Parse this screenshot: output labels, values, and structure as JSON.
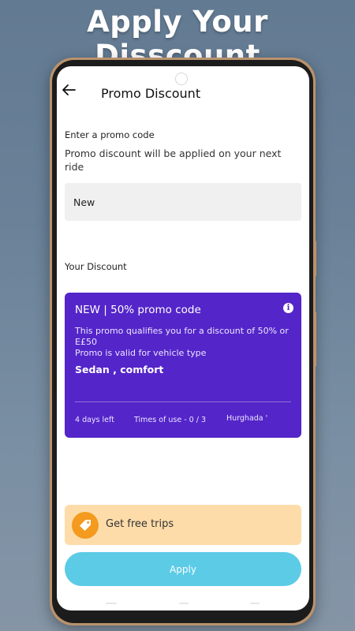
{
  "banner": {
    "headline": "Apply Your Disscount"
  },
  "header": {
    "title": "Promo Discount",
    "back_icon": "arrow-left-icon"
  },
  "promo_entry": {
    "label": "Enter a promo code",
    "description": "Promo discount will be applied on your next ride",
    "code_value": "New"
  },
  "discount_section": {
    "label": "Your Discount",
    "card": {
      "title": "NEW | 50% promo code",
      "info_icon": "info-icon",
      "description": "This promo qualifies you for a discount of 50% or E£50",
      "valid_label": "Promo is valid for vehicle type",
      "vehicle_types": "Sedan , comfort",
      "days_left": "4 days left",
      "times_of_use": "Times of use - 0 / 3",
      "city": "Hurghada '",
      "background_color": "#5425c9"
    }
  },
  "free_trips": {
    "label": "Get free trips",
    "icon": "tag-icon",
    "icon_color": "#f39a1f",
    "background_color": "#fddcaa"
  },
  "apply_button": {
    "label": "Apply",
    "color": "#5ccbe6"
  }
}
